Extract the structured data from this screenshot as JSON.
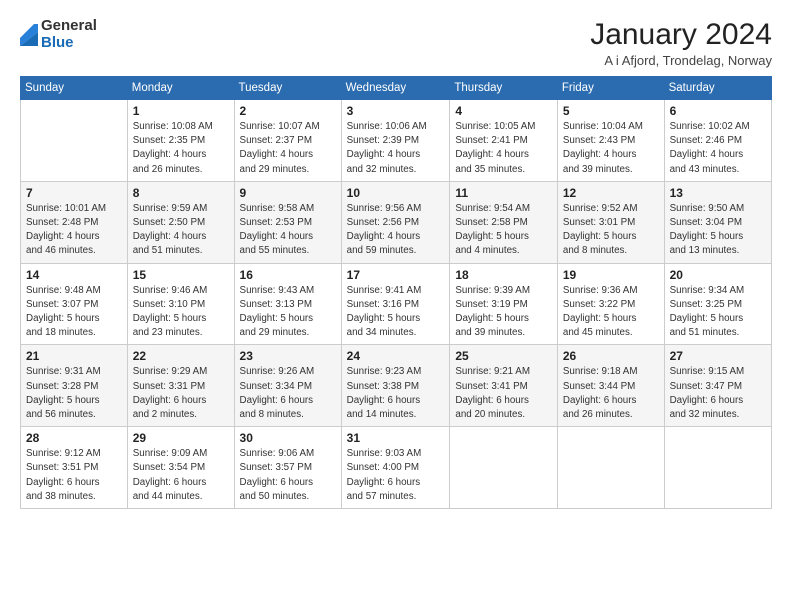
{
  "logo": {
    "general": "General",
    "blue": "Blue"
  },
  "title": "January 2024",
  "location": "A i Afjord, Trondelag, Norway",
  "days_header": [
    "Sunday",
    "Monday",
    "Tuesday",
    "Wednesday",
    "Thursday",
    "Friday",
    "Saturday"
  ],
  "weeks": [
    [
      {
        "day": "",
        "info": ""
      },
      {
        "day": "1",
        "info": "Sunrise: 10:08 AM\nSunset: 2:35 PM\nDaylight: 4 hours\nand 26 minutes."
      },
      {
        "day": "2",
        "info": "Sunrise: 10:07 AM\nSunset: 2:37 PM\nDaylight: 4 hours\nand 29 minutes."
      },
      {
        "day": "3",
        "info": "Sunrise: 10:06 AM\nSunset: 2:39 PM\nDaylight: 4 hours\nand 32 minutes."
      },
      {
        "day": "4",
        "info": "Sunrise: 10:05 AM\nSunset: 2:41 PM\nDaylight: 4 hours\nand 35 minutes."
      },
      {
        "day": "5",
        "info": "Sunrise: 10:04 AM\nSunset: 2:43 PM\nDaylight: 4 hours\nand 39 minutes."
      },
      {
        "day": "6",
        "info": "Sunrise: 10:02 AM\nSunset: 2:46 PM\nDaylight: 4 hours\nand 43 minutes."
      }
    ],
    [
      {
        "day": "7",
        "info": "Sunrise: 10:01 AM\nSunset: 2:48 PM\nDaylight: 4 hours\nand 46 minutes."
      },
      {
        "day": "8",
        "info": "Sunrise: 9:59 AM\nSunset: 2:50 PM\nDaylight: 4 hours\nand 51 minutes."
      },
      {
        "day": "9",
        "info": "Sunrise: 9:58 AM\nSunset: 2:53 PM\nDaylight: 4 hours\nand 55 minutes."
      },
      {
        "day": "10",
        "info": "Sunrise: 9:56 AM\nSunset: 2:56 PM\nDaylight: 4 hours\nand 59 minutes."
      },
      {
        "day": "11",
        "info": "Sunrise: 9:54 AM\nSunset: 2:58 PM\nDaylight: 5 hours\nand 4 minutes."
      },
      {
        "day": "12",
        "info": "Sunrise: 9:52 AM\nSunset: 3:01 PM\nDaylight: 5 hours\nand 8 minutes."
      },
      {
        "day": "13",
        "info": "Sunrise: 9:50 AM\nSunset: 3:04 PM\nDaylight: 5 hours\nand 13 minutes."
      }
    ],
    [
      {
        "day": "14",
        "info": "Sunrise: 9:48 AM\nSunset: 3:07 PM\nDaylight: 5 hours\nand 18 minutes."
      },
      {
        "day": "15",
        "info": "Sunrise: 9:46 AM\nSunset: 3:10 PM\nDaylight: 5 hours\nand 23 minutes."
      },
      {
        "day": "16",
        "info": "Sunrise: 9:43 AM\nSunset: 3:13 PM\nDaylight: 5 hours\nand 29 minutes."
      },
      {
        "day": "17",
        "info": "Sunrise: 9:41 AM\nSunset: 3:16 PM\nDaylight: 5 hours\nand 34 minutes."
      },
      {
        "day": "18",
        "info": "Sunrise: 9:39 AM\nSunset: 3:19 PM\nDaylight: 5 hours\nand 39 minutes."
      },
      {
        "day": "19",
        "info": "Sunrise: 9:36 AM\nSunset: 3:22 PM\nDaylight: 5 hours\nand 45 minutes."
      },
      {
        "day": "20",
        "info": "Sunrise: 9:34 AM\nSunset: 3:25 PM\nDaylight: 5 hours\nand 51 minutes."
      }
    ],
    [
      {
        "day": "21",
        "info": "Sunrise: 9:31 AM\nSunset: 3:28 PM\nDaylight: 5 hours\nand 56 minutes."
      },
      {
        "day": "22",
        "info": "Sunrise: 9:29 AM\nSunset: 3:31 PM\nDaylight: 6 hours\nand 2 minutes."
      },
      {
        "day": "23",
        "info": "Sunrise: 9:26 AM\nSunset: 3:34 PM\nDaylight: 6 hours\nand 8 minutes."
      },
      {
        "day": "24",
        "info": "Sunrise: 9:23 AM\nSunset: 3:38 PM\nDaylight: 6 hours\nand 14 minutes."
      },
      {
        "day": "25",
        "info": "Sunrise: 9:21 AM\nSunset: 3:41 PM\nDaylight: 6 hours\nand 20 minutes."
      },
      {
        "day": "26",
        "info": "Sunrise: 9:18 AM\nSunset: 3:44 PM\nDaylight: 6 hours\nand 26 minutes."
      },
      {
        "day": "27",
        "info": "Sunrise: 9:15 AM\nSunset: 3:47 PM\nDaylight: 6 hours\nand 32 minutes."
      }
    ],
    [
      {
        "day": "28",
        "info": "Sunrise: 9:12 AM\nSunset: 3:51 PM\nDaylight: 6 hours\nand 38 minutes."
      },
      {
        "day": "29",
        "info": "Sunrise: 9:09 AM\nSunset: 3:54 PM\nDaylight: 6 hours\nand 44 minutes."
      },
      {
        "day": "30",
        "info": "Sunrise: 9:06 AM\nSunset: 3:57 PM\nDaylight: 6 hours\nand 50 minutes."
      },
      {
        "day": "31",
        "info": "Sunrise: 9:03 AM\nSunset: 4:00 PM\nDaylight: 6 hours\nand 57 minutes."
      },
      {
        "day": "",
        "info": ""
      },
      {
        "day": "",
        "info": ""
      },
      {
        "day": "",
        "info": ""
      }
    ]
  ]
}
